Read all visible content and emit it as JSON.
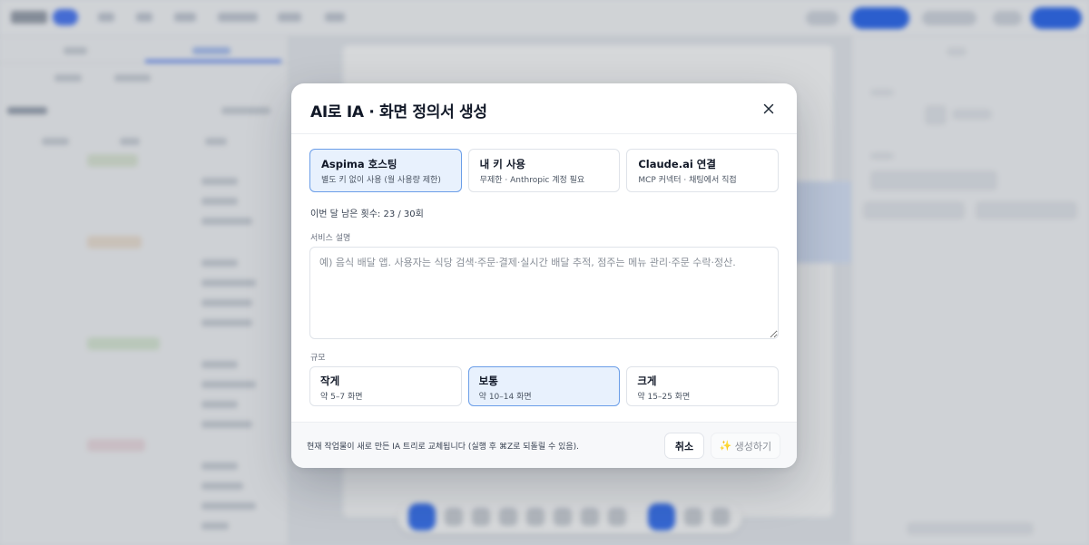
{
  "modal": {
    "title": "AI로 IA · 화면 정의서 생성",
    "modes": [
      {
        "title": "Aspima 호스팅",
        "subtitle": "별도 키 없이 사용 (월 사용량 제한)",
        "selected": true
      },
      {
        "title": "내 키 사용",
        "subtitle": "무제한 · Anthropic 계정 필요",
        "selected": false
      },
      {
        "title": "Claude.ai 연결",
        "subtitle": "MCP 커넥터 · 채팅에서 직접",
        "selected": false
      }
    ],
    "remaining_text": "이번 달 남은 횟수: 23 / 30회",
    "description": {
      "label": "서비스 설명",
      "value": "",
      "placeholder": "예) 음식 배달 앱. 사용자는 식당 검색·주문·결제·실시간 배달 추적, 점주는 메뉴 관리·주문 수락·정산."
    },
    "scale": {
      "label": "규모",
      "options": [
        {
          "title": "작게",
          "subtitle": "약 5–7 화면",
          "selected": false
        },
        {
          "title": "보통",
          "subtitle": "약 10–14 화면",
          "selected": true
        },
        {
          "title": "크게",
          "subtitle": "약 15–25 화면",
          "selected": false
        }
      ]
    },
    "footer": {
      "note": "현재 작업물이 새로 만든 IA 트리로 교체됩니다 (실행 후 ⌘Z로 되돌릴 수 있음).",
      "cancel_label": "취소",
      "generate_label": "생성하기",
      "generate_icon": "sparkle-icon",
      "generate_icon_glyph": "✨"
    }
  },
  "colors": {
    "accent": "#6b9ee8",
    "selected_bg": "#e8f1fd",
    "primary_blue": "#2f6bf0"
  }
}
